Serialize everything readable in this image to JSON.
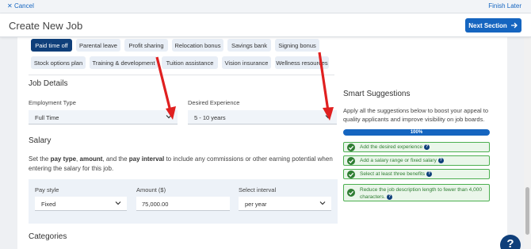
{
  "topbar": {
    "cancel_label": "Cancel",
    "finish_label": "Finish Later"
  },
  "header": {
    "title": "Create New Job",
    "next_label": "Next Section"
  },
  "benefits": [
    {
      "label": "Paid time off",
      "selected": true
    },
    {
      "label": "Parental leave",
      "selected": false
    },
    {
      "label": "Profit sharing",
      "selected": false
    },
    {
      "label": "Relocation bonus",
      "selected": false
    },
    {
      "label": "Savings bank",
      "selected": false
    },
    {
      "label": "Signing bonus",
      "selected": false
    },
    {
      "label": "Stock options plan",
      "selected": false
    },
    {
      "label": "Training & development",
      "selected": false
    },
    {
      "label": "Tuition assistance",
      "selected": false
    },
    {
      "label": "Vision insurance",
      "selected": false
    },
    {
      "label": "Wellness resources",
      "selected": false
    }
  ],
  "job_details": {
    "heading": "Job Details",
    "employment_type": {
      "label": "Employment Type",
      "value": "Full Time"
    },
    "desired_experience": {
      "label": "Desired Experience",
      "value": "5 - 10 years"
    }
  },
  "salary": {
    "heading": "Salary",
    "desc_1": "Set the ",
    "desc_b1": "pay type",
    "desc_2": ", ",
    "desc_b2": "amount",
    "desc_3": ", and the ",
    "desc_b3": "pay interval",
    "desc_4": " to include any commissions or other earning potential when entering the salary for this job.",
    "pay_style": {
      "label": "Pay style",
      "value": "Fixed"
    },
    "amount": {
      "label": "Amount ($)",
      "value": "75,000.00"
    },
    "interval": {
      "label": "Select interval",
      "value": "per year"
    }
  },
  "categories": {
    "heading": "Categories"
  },
  "smart": {
    "heading": "Smart Suggestions",
    "description": "Apply all the suggestions below to boost your appeal to quality applicants and improve visibility on job boards.",
    "progress_label": "100%",
    "progress_percent": 100,
    "items": [
      {
        "text": "Add the desired experience"
      },
      {
        "text": "Add a salary range or fixed salary"
      },
      {
        "text": "Select at least three benefits"
      },
      {
        "text_line1": "Reduce the job description length to fewer than 4,000",
        "text_line2": "characters."
      }
    ]
  },
  "help": {
    "label": "?"
  },
  "colors": {
    "primary": "#1565c0",
    "dark_navy": "#0f3f7a",
    "success": "#2e7d32",
    "annotation_red": "#e02020"
  },
  "icons": [
    "close-icon",
    "arrow-right-icon",
    "chevron-down-icon",
    "check-circle-icon",
    "question-circle-icon",
    "help-icon"
  ]
}
